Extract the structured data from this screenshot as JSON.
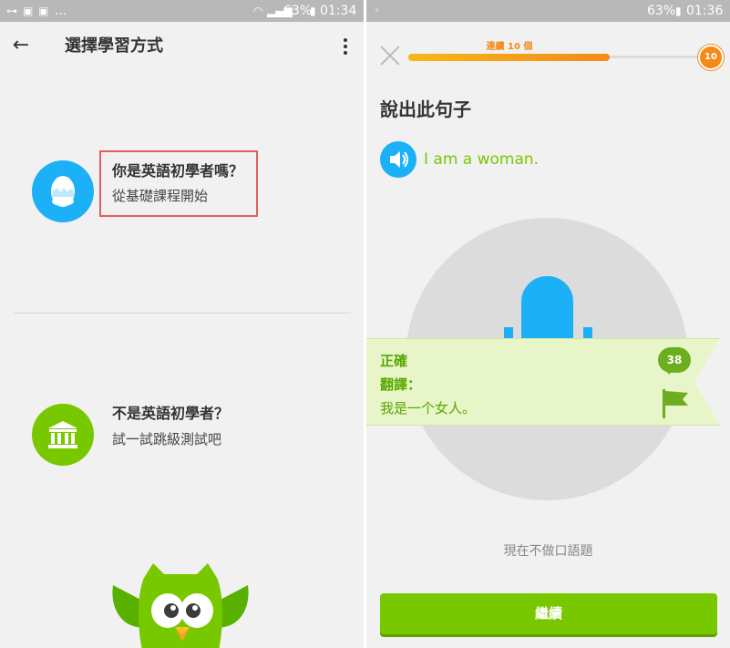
{
  "left_screen": {
    "statusbar": {
      "battery_percent": "63%",
      "time": "01:34",
      "more": "..."
    },
    "header": {
      "title": "選擇學習方式"
    },
    "beginner_option": {
      "title": "你是英語初學者嗎？",
      "subtitle": "從基礎課程開始",
      "icon": "egg-icon"
    },
    "placement_option": {
      "title": "不是英語初學者？",
      "subtitle": "試一試跳級測試吧",
      "icon": "building-icon"
    }
  },
  "right_screen": {
    "statusbar": {
      "battery_percent": "63%",
      "time": "01:36"
    },
    "progress": {
      "streak_label": "連續 10 個",
      "badge": "10",
      "fraction": 0.69
    },
    "heading": "說出此句子",
    "sentence": "I am a woman.",
    "result": {
      "status": "正確",
      "translation_label": "翻譯：",
      "translation": "我是一个女人。",
      "comments_count": "38"
    },
    "cant_speak_link": "現在不做口語題",
    "continue_button": "繼續"
  },
  "colors": {
    "accent_blue": "#1cb0f6",
    "accent_green": "#78c800",
    "accent_orange": "#f48a1a",
    "highlight_red": "#e06060"
  }
}
